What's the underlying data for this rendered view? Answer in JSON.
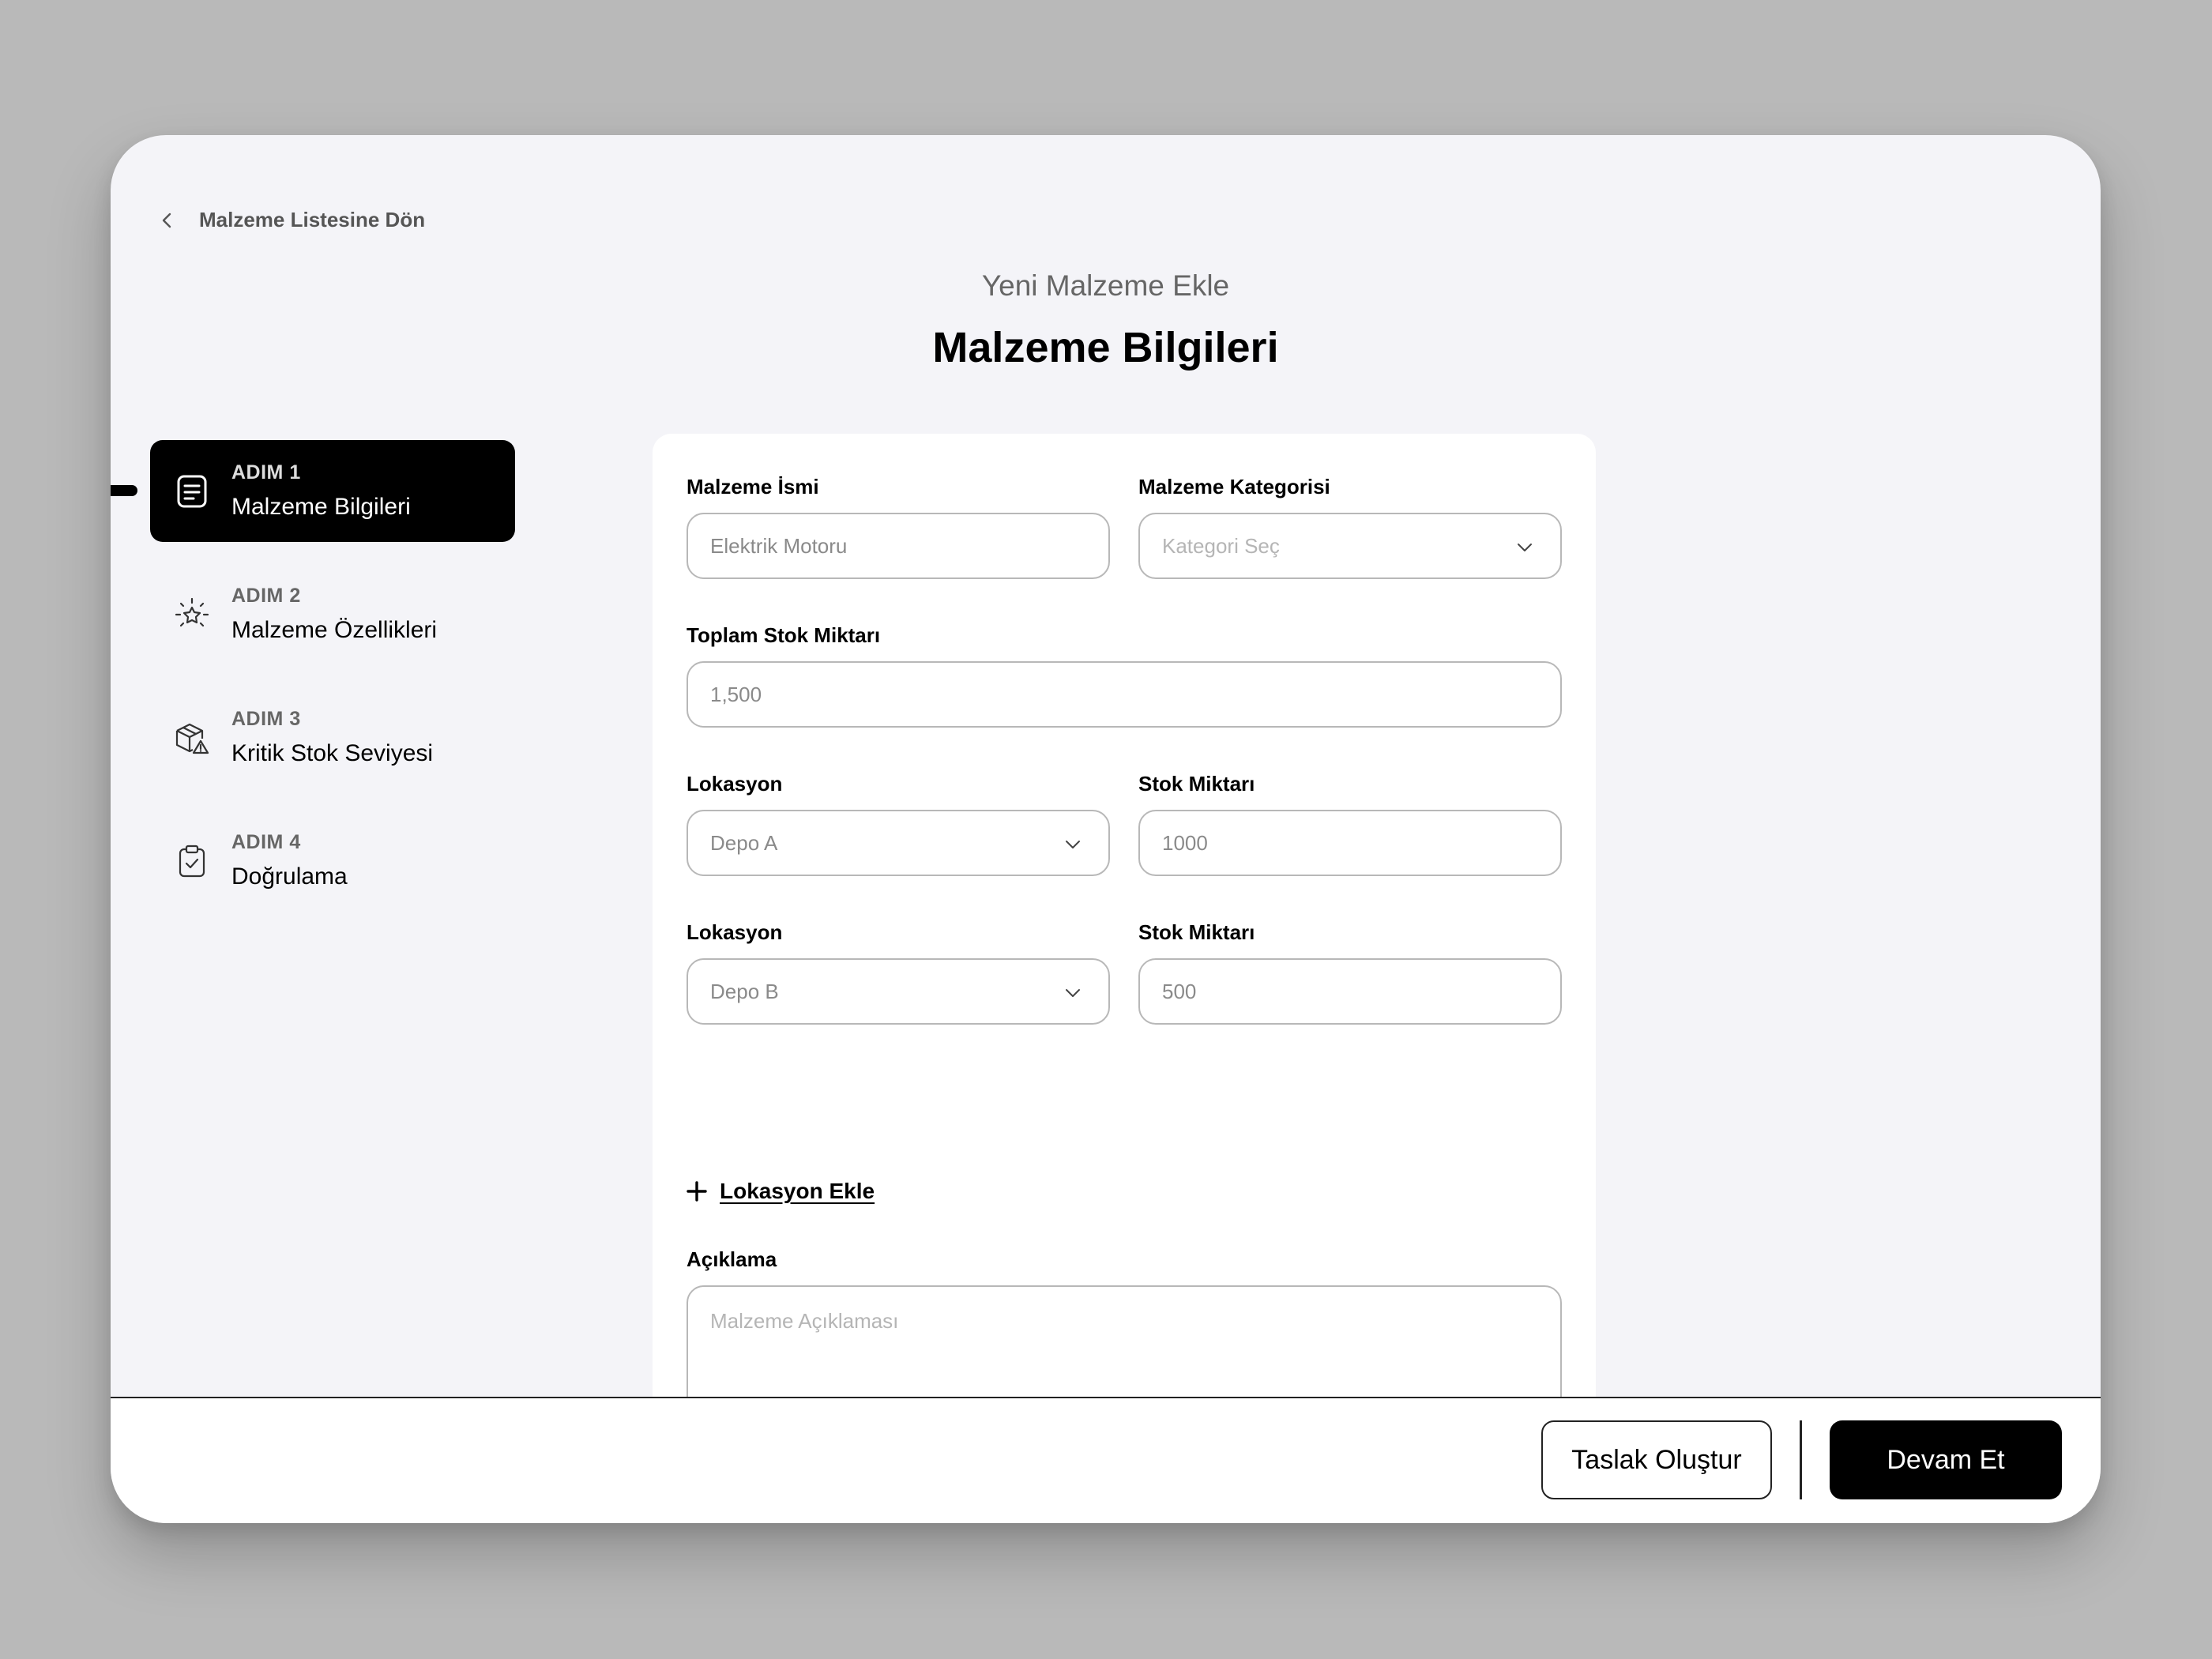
{
  "back_link": {
    "label": "Malzeme Listesine Dön",
    "icon": "chevron-left-icon"
  },
  "header": {
    "subtitle": "Yeni Malzeme Ekle",
    "title": "Malzeme Bilgileri"
  },
  "steps": [
    {
      "number": "ADIM 1",
      "name": "Malzeme Bilgileri",
      "icon": "document-icon",
      "active": true
    },
    {
      "number": "ADIM 2",
      "name": "Malzeme Özellikleri",
      "icon": "sparkle-icon",
      "active": false
    },
    {
      "number": "ADIM 3",
      "name": "Kritik Stok Seviyesi",
      "icon": "box-warning-icon",
      "active": false
    },
    {
      "number": "ADIM 4",
      "name": "Doğrulama",
      "icon": "clipboard-check-icon",
      "active": false
    }
  ],
  "form": {
    "name": {
      "label": "Malzeme İsmi",
      "value": "Elektrik Motoru"
    },
    "category": {
      "label": "Malzeme Kategorisi",
      "placeholder": "Kategori Seç"
    },
    "total_stock": {
      "label": "Toplam Stok Miktarı",
      "value": "1,500"
    },
    "locations": [
      {
        "location_label": "Lokasyon",
        "location_value": "Depo A",
        "stock_label": "Stok Miktarı",
        "stock_value": "1000"
      },
      {
        "location_label": "Lokasyon",
        "location_value": "Depo B",
        "stock_label": "Stok Miktarı",
        "stock_value": "500"
      }
    ],
    "add_location": "Lokasyon Ekle",
    "description": {
      "label": "Açıklama",
      "placeholder": "Malzeme Açıklaması"
    }
  },
  "footer": {
    "draft_button": "Taslak Oluştur",
    "next_button": "Devam Et"
  }
}
